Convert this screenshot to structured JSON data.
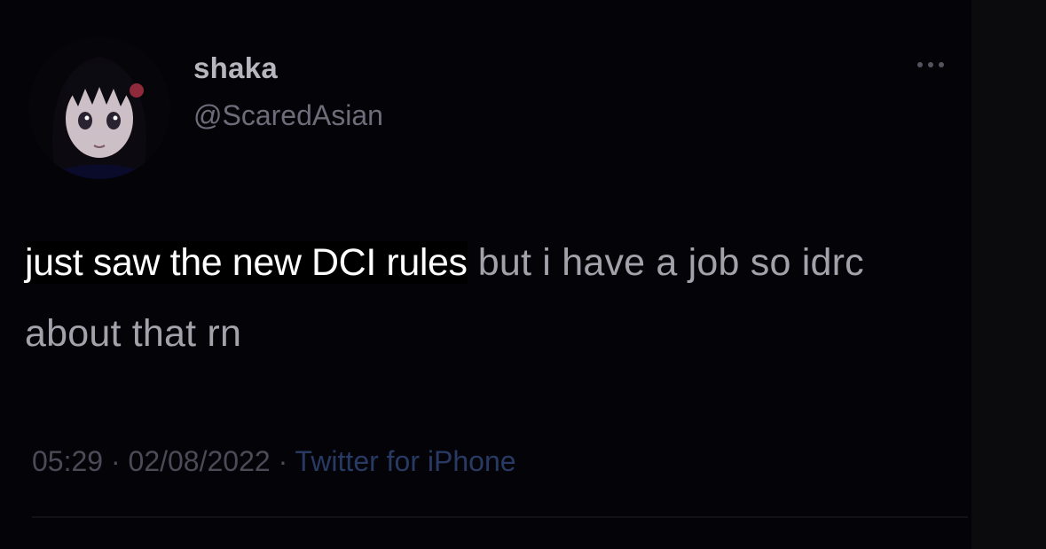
{
  "tweet": {
    "display_name": "shaka",
    "handle": "@ScaredAsian",
    "overlay_text": "just saw the new DCI rules",
    "body_text": " but i have a job so idrc about that rn",
    "time": "05:29",
    "separator": " · ",
    "date": "02/08/2022",
    "source": "Twitter for iPhone",
    "avatar_icon": "anime-girl-avatar",
    "more_icon": "more-options-icon"
  },
  "colors": {
    "background": "#040308",
    "display_name": "#b7b5bd",
    "handle": "#6e6c78",
    "body_text": "#a3a1aa",
    "overlay_text": "#ffffff",
    "meta": "#4c4a56",
    "source_link": "#283a63"
  }
}
